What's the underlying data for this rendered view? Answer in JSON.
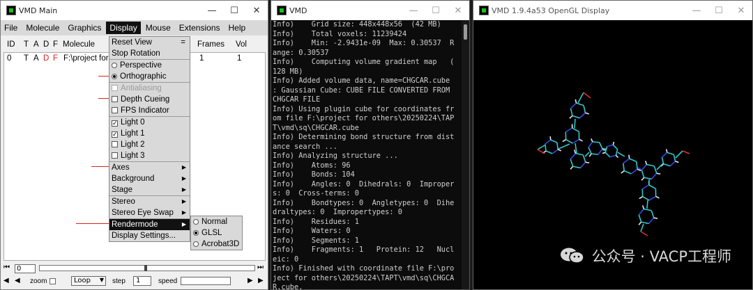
{
  "main_window": {
    "title": "VMD Main",
    "controls": {
      "minimize": "—",
      "maximize": "☐",
      "close": "✕"
    },
    "menu": [
      "File",
      "Molecule",
      "Graphics",
      "Display",
      "Mouse",
      "Extensions",
      "Help"
    ],
    "columns": {
      "id": "ID",
      "t": "T",
      "a": "A",
      "d": "D",
      "f": "F",
      "molecule": "Molecule",
      "frames": "Frames",
      "vol": "Vol"
    },
    "molecule_row": {
      "id": "0",
      "t": "T",
      "a": "A",
      "d": "D",
      "f": "F",
      "molecule": "F:\\project for",
      "frames": "1",
      "vol": "1"
    },
    "display_menu": {
      "reset_view": "Reset View",
      "tearoff": "=",
      "stop_rotation": "Stop Rotation",
      "perspective": "Perspective",
      "orthographic": "Orthographic",
      "antialiasing": "Antialiasing",
      "depth_cueing": "Depth Cueing",
      "fps_indicator": "FPS Indicator",
      "light0": "Light 0",
      "light1": "Light 1",
      "light2": "Light 2",
      "light3": "Light 3",
      "axes": "Axes",
      "background": "Background",
      "stage": "Stage",
      "stereo": "Stereo",
      "stereo_eye_swap": "Stereo Eye Swap",
      "rendermode": "Rendermode",
      "display_settings": "Display Settings..."
    },
    "rendermode_submenu": {
      "normal": "Normal",
      "glsl": "GLSL",
      "acrobat3d": "Acrobat3D",
      "selected": "GLSL"
    },
    "bottom": {
      "frame_value": "0",
      "zoom_label": "zoom",
      "loop_value": "Loop",
      "step_label": "step",
      "step_value": "1",
      "speed_label": "speed"
    }
  },
  "console_window": {
    "title": "VMD",
    "lines": [
      "Info)    Grid size: 448x448x56  (42 MB)",
      "Info)    Total voxels: 11239424",
      "Info)    Min: -2.9431e-09  Max: 0.30537  R",
      "ange: 0.30537",
      "Info)    Computing volume gradient map   (",
      "128 MB)",
      "Info) Added volume data, name=CHGCAR.cube",
      ": Gaussian Cube: CUBE FILE CONVERTED FROM",
      "CHGCAR FILE",
      "Info) Using plugin cube for coordinates fr",
      "om file F:\\project for others\\20250224\\TAP",
      "T\\vmd\\sq\\CHGCAR.cube",
      "Info) Determining bond structure from dist",
      "ance search ...",
      "Info) Analyzing structure ...",
      "Info)    Atoms: 96",
      "Info)    Bonds: 104",
      "Info)    Angles: 0  Dihedrals: 0  Improper",
      "s: 0  Cross-terms: 0",
      "Info)    Bondtypes: 0  Angletypes: 0  Dihe",
      "draltypes: 0  Impropertypes: 0",
      "Info)    Residues: 1",
      "Info)    Waters: 0",
      "Info)    Segments: 1",
      "Info)    Fragments: 1   Protein: 12   Nucl",
      "eic: 0",
      "Info) Finished with coordinate file F:\\pro",
      "ject for others\\20250224\\TAPT\\vmd\\sq\\CHGCA",
      "R.cube."
    ]
  },
  "gl_window": {
    "title": "VMD 1.9.4a53 OpenGL Display",
    "watermark": "公众号 · VACP工程师",
    "colors": {
      "carbon": "#33c8cc",
      "nitrogen": "#3a46e8",
      "oxygen": "#e03030",
      "hydrogen": "#e8e8e8"
    }
  }
}
